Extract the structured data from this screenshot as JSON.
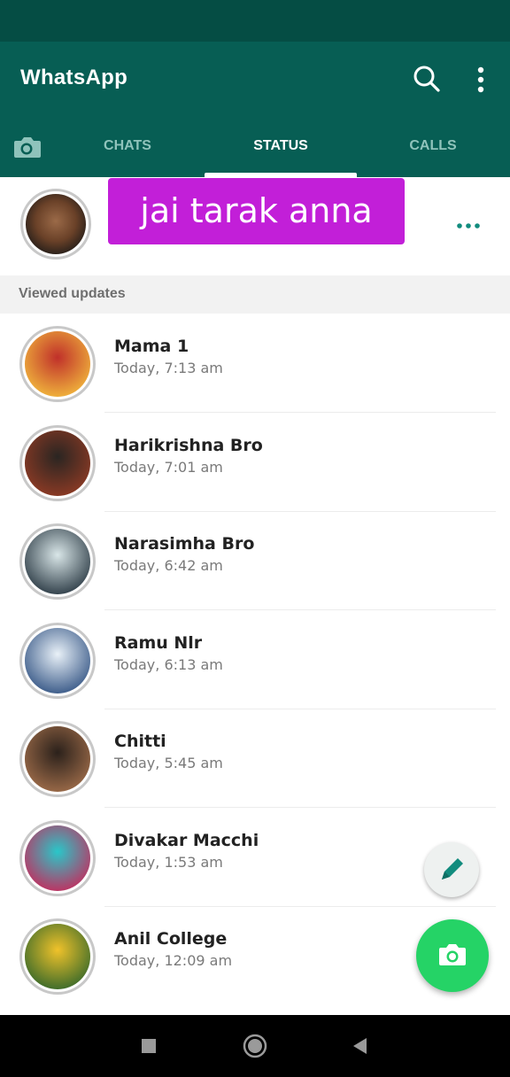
{
  "app": {
    "title": "WhatsApp"
  },
  "tabs": [
    {
      "label": "CHATS",
      "active": false
    },
    {
      "label": "STATUS",
      "active": true
    },
    {
      "label": "CALLS",
      "active": false
    }
  ],
  "my_status": {
    "overlay_text": "jai tarak anna"
  },
  "section": {
    "title": "Viewed updates"
  },
  "contacts": [
    {
      "name": "Mama 1",
      "time": "Today, 7:13 am",
      "avatar_colors": [
        "#c0302a",
        "#f0b43c"
      ]
    },
    {
      "name": "Harikrishna Bro",
      "time": "Today, 7:01 am",
      "avatar_colors": [
        "#2a2522",
        "#8c3a24"
      ]
    },
    {
      "name": "Narasimha Bro",
      "time": "Today, 6:42 am",
      "avatar_colors": [
        "#d9e6e8",
        "#2f3e48"
      ]
    },
    {
      "name": "Ramu Nlr",
      "time": "Today, 6:13 am",
      "avatar_colors": [
        "#e9f1f8",
        "#3a5a88"
      ]
    },
    {
      "name": "Chitti",
      "time": "Today, 5:45 am",
      "avatar_colors": [
        "#2b211b",
        "#9b6a48"
      ]
    },
    {
      "name": "Divakar Macchi",
      "time": "Today, 1:53 am",
      "avatar_colors": [
        "#29c7c9",
        "#c03060"
      ]
    },
    {
      "name": "Anil College",
      "time": "Today, 12:09 am",
      "avatar_colors": [
        "#f0c22a",
        "#3a6a2a"
      ]
    }
  ],
  "colors": {
    "primary": "#075e54",
    "statusbar": "#054d44",
    "accent": "#25d366",
    "overlay": "#c21fd8"
  },
  "icons": {
    "search": "search-icon",
    "more": "more-vertical-icon",
    "camera": "camera-icon",
    "pencil": "pencil-icon"
  }
}
